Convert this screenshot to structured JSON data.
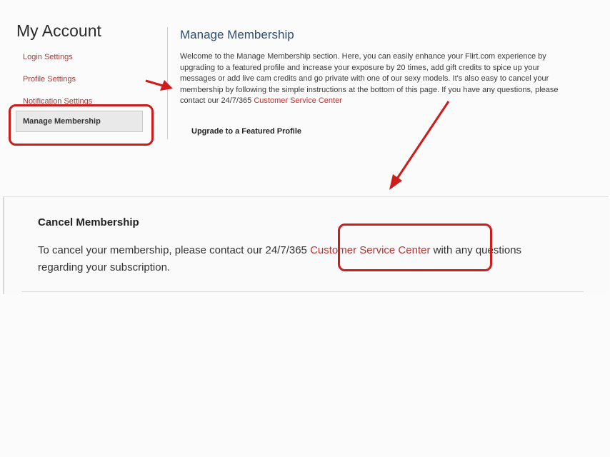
{
  "sidebar": {
    "title": "My Account",
    "items": [
      {
        "label": "Login Settings"
      },
      {
        "label": "Profile Settings"
      },
      {
        "label": "Notification Settings"
      },
      {
        "label": "Manage Membership"
      }
    ]
  },
  "main": {
    "section_title": "Manage Membership",
    "intro_text": "Welcome to the Manage Membership section. Here, you can easily enhance your Flirt.com experience by upgrading to a featured profile and increase your exposure by 20 times, add gift credits to spice up your messages or add live cam credits and go private with one of our sexy models. It's also easy to cancel your membership by following the simple instructions at the bottom of this page. If you have any questions, please contact our 24/7/365",
    "intro_link": "Customer Service Center",
    "upgrade_label": "Upgrade to a Featured Profile"
  },
  "cancel": {
    "title": "Cancel Membership",
    "text_before": "To cancel your membership, please contact our 24/7/365 ",
    "link": "Customer Service Center",
    "text_after": " with any questions regarding your subscription."
  },
  "colors": {
    "annotation_red": "#cc1c1c",
    "link_red": "#b83232",
    "heading_blue": "#2e4e72"
  }
}
